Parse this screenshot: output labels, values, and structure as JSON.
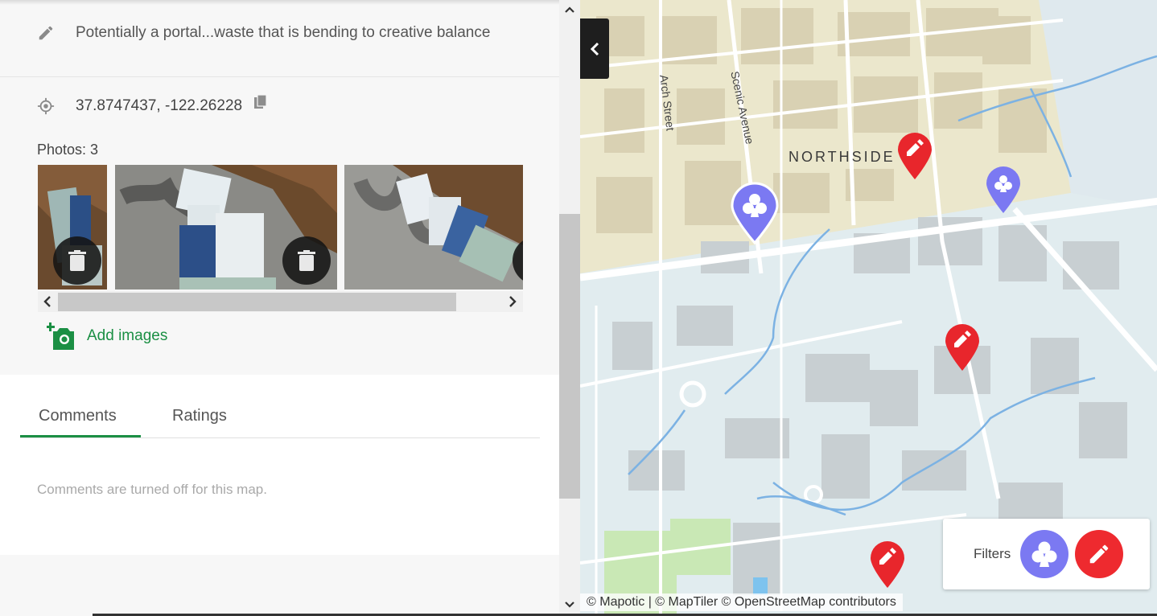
{
  "place": {
    "description": "Potentially a portal...waste that is bending to creative balance",
    "coordinates": "37.8747437, -122.26228",
    "photos_label": "Photos: 3",
    "photo_count": 3,
    "add_images_label": "Add images"
  },
  "tabs": [
    {
      "label": "Comments",
      "active": true
    },
    {
      "label": "Ratings",
      "active": false
    }
  ],
  "comments": {
    "message": "Comments are turned off for this map."
  },
  "map": {
    "street_labels": {
      "arch": "Arch Street",
      "scenic": "Scenic Avenue",
      "northside": "NORTHSIDE"
    },
    "attribution": "© Mapotic | © MapTiler © OpenStreetMap contributors",
    "filters_label": "Filters",
    "marker_colors": {
      "club": "#7b79f2",
      "pencil": "#ee2a2f"
    },
    "markers": [
      {
        "type": "club",
        "icon": "club-icon"
      },
      {
        "type": "pencil",
        "icon": "pencil-icon"
      },
      {
        "type": "club",
        "icon": "club-icon"
      },
      {
        "type": "pencil",
        "icon": "pencil-icon"
      },
      {
        "type": "pencil",
        "icon": "pencil-icon"
      }
    ]
  },
  "icons": [
    "pencil-icon",
    "location-target-icon",
    "copy-icon",
    "trash-icon",
    "add-photo-icon",
    "chevron-left-icon",
    "chevron-right-icon",
    "chevron-up-icon",
    "chevron-down-icon"
  ]
}
